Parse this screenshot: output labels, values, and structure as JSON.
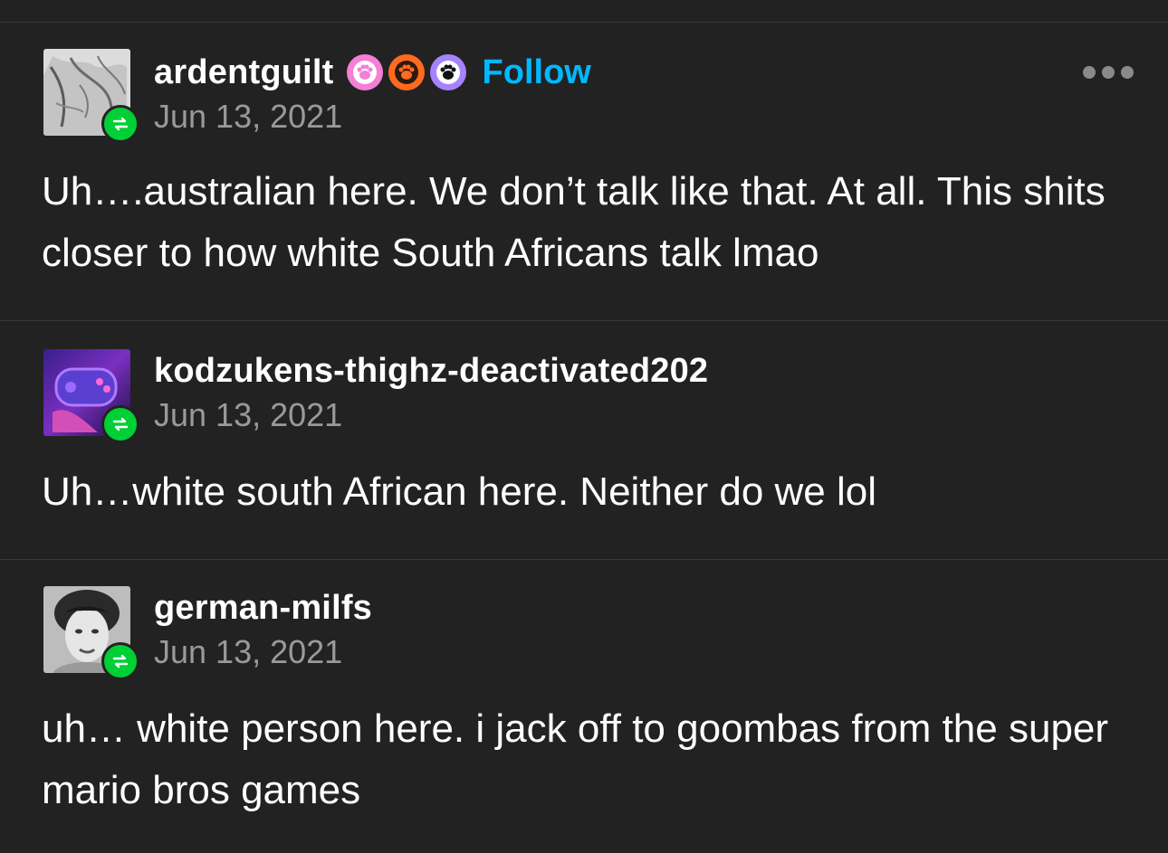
{
  "posts": [
    {
      "username": "ardentguilt",
      "follow_label": "Follow",
      "date": "Jun 13, 2021",
      "text": "Uh….australian here. We don’t talk like that. At all. This shits closer to how white South Africans talk lmao",
      "badges": [
        {
          "icon": "pink-paw-icon",
          "color": "#f47fd6"
        },
        {
          "icon": "orange-paw-icon",
          "color": "#ff6a1f"
        },
        {
          "icon": "purple-paw-icon",
          "color": "#a583ff"
        }
      ]
    },
    {
      "username": "kodzukens-thighz-deactivated202",
      "date": "Jun 13, 2021",
      "text": "Uh…white south African here. Neither do we lol"
    },
    {
      "username": "german-milfs",
      "date": "Jun 13, 2021",
      "text": "uh… white person here. i jack off to goombas from the super mario bros games"
    }
  ],
  "colors": {
    "background": "#222222",
    "accent_follow": "#00b8ff",
    "reblog_green": "#00cf35",
    "date_gray": "#9a9a9a"
  },
  "icons": {
    "reblog": "reblog-icon",
    "more": "more-options-icon"
  }
}
